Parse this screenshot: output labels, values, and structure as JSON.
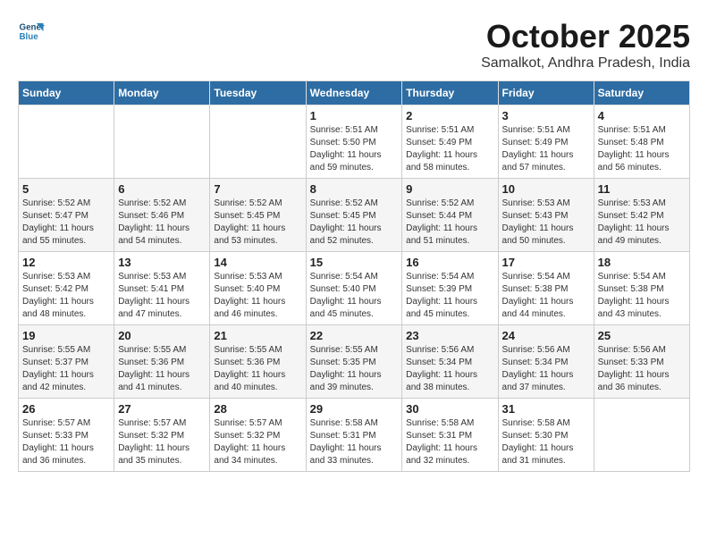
{
  "header": {
    "logo_line1": "General",
    "logo_line2": "Blue",
    "month": "October 2025",
    "location": "Samalkot, Andhra Pradesh, India"
  },
  "weekdays": [
    "Sunday",
    "Monday",
    "Tuesday",
    "Wednesday",
    "Thursday",
    "Friday",
    "Saturday"
  ],
  "weeks": [
    [
      {
        "day": "",
        "info": ""
      },
      {
        "day": "",
        "info": ""
      },
      {
        "day": "",
        "info": ""
      },
      {
        "day": "1",
        "info": "Sunrise: 5:51 AM\nSunset: 5:50 PM\nDaylight: 11 hours and 59 minutes."
      },
      {
        "day": "2",
        "info": "Sunrise: 5:51 AM\nSunset: 5:49 PM\nDaylight: 11 hours and 58 minutes."
      },
      {
        "day": "3",
        "info": "Sunrise: 5:51 AM\nSunset: 5:49 PM\nDaylight: 11 hours and 57 minutes."
      },
      {
        "day": "4",
        "info": "Sunrise: 5:51 AM\nSunset: 5:48 PM\nDaylight: 11 hours and 56 minutes."
      }
    ],
    [
      {
        "day": "5",
        "info": "Sunrise: 5:52 AM\nSunset: 5:47 PM\nDaylight: 11 hours and 55 minutes."
      },
      {
        "day": "6",
        "info": "Sunrise: 5:52 AM\nSunset: 5:46 PM\nDaylight: 11 hours and 54 minutes."
      },
      {
        "day": "7",
        "info": "Sunrise: 5:52 AM\nSunset: 5:45 PM\nDaylight: 11 hours and 53 minutes."
      },
      {
        "day": "8",
        "info": "Sunrise: 5:52 AM\nSunset: 5:45 PM\nDaylight: 11 hours and 52 minutes."
      },
      {
        "day": "9",
        "info": "Sunrise: 5:52 AM\nSunset: 5:44 PM\nDaylight: 11 hours and 51 minutes."
      },
      {
        "day": "10",
        "info": "Sunrise: 5:53 AM\nSunset: 5:43 PM\nDaylight: 11 hours and 50 minutes."
      },
      {
        "day": "11",
        "info": "Sunrise: 5:53 AM\nSunset: 5:42 PM\nDaylight: 11 hours and 49 minutes."
      }
    ],
    [
      {
        "day": "12",
        "info": "Sunrise: 5:53 AM\nSunset: 5:42 PM\nDaylight: 11 hours and 48 minutes."
      },
      {
        "day": "13",
        "info": "Sunrise: 5:53 AM\nSunset: 5:41 PM\nDaylight: 11 hours and 47 minutes."
      },
      {
        "day": "14",
        "info": "Sunrise: 5:53 AM\nSunset: 5:40 PM\nDaylight: 11 hours and 46 minutes."
      },
      {
        "day": "15",
        "info": "Sunrise: 5:54 AM\nSunset: 5:40 PM\nDaylight: 11 hours and 45 minutes."
      },
      {
        "day": "16",
        "info": "Sunrise: 5:54 AM\nSunset: 5:39 PM\nDaylight: 11 hours and 45 minutes."
      },
      {
        "day": "17",
        "info": "Sunrise: 5:54 AM\nSunset: 5:38 PM\nDaylight: 11 hours and 44 minutes."
      },
      {
        "day": "18",
        "info": "Sunrise: 5:54 AM\nSunset: 5:38 PM\nDaylight: 11 hours and 43 minutes."
      }
    ],
    [
      {
        "day": "19",
        "info": "Sunrise: 5:55 AM\nSunset: 5:37 PM\nDaylight: 11 hours and 42 minutes."
      },
      {
        "day": "20",
        "info": "Sunrise: 5:55 AM\nSunset: 5:36 PM\nDaylight: 11 hours and 41 minutes."
      },
      {
        "day": "21",
        "info": "Sunrise: 5:55 AM\nSunset: 5:36 PM\nDaylight: 11 hours and 40 minutes."
      },
      {
        "day": "22",
        "info": "Sunrise: 5:55 AM\nSunset: 5:35 PM\nDaylight: 11 hours and 39 minutes."
      },
      {
        "day": "23",
        "info": "Sunrise: 5:56 AM\nSunset: 5:34 PM\nDaylight: 11 hours and 38 minutes."
      },
      {
        "day": "24",
        "info": "Sunrise: 5:56 AM\nSunset: 5:34 PM\nDaylight: 11 hours and 37 minutes."
      },
      {
        "day": "25",
        "info": "Sunrise: 5:56 AM\nSunset: 5:33 PM\nDaylight: 11 hours and 36 minutes."
      }
    ],
    [
      {
        "day": "26",
        "info": "Sunrise: 5:57 AM\nSunset: 5:33 PM\nDaylight: 11 hours and 36 minutes."
      },
      {
        "day": "27",
        "info": "Sunrise: 5:57 AM\nSunset: 5:32 PM\nDaylight: 11 hours and 35 minutes."
      },
      {
        "day": "28",
        "info": "Sunrise: 5:57 AM\nSunset: 5:32 PM\nDaylight: 11 hours and 34 minutes."
      },
      {
        "day": "29",
        "info": "Sunrise: 5:58 AM\nSunset: 5:31 PM\nDaylight: 11 hours and 33 minutes."
      },
      {
        "day": "30",
        "info": "Sunrise: 5:58 AM\nSunset: 5:31 PM\nDaylight: 11 hours and 32 minutes."
      },
      {
        "day": "31",
        "info": "Sunrise: 5:58 AM\nSunset: 5:30 PM\nDaylight: 11 hours and 31 minutes."
      },
      {
        "day": "",
        "info": ""
      }
    ]
  ]
}
